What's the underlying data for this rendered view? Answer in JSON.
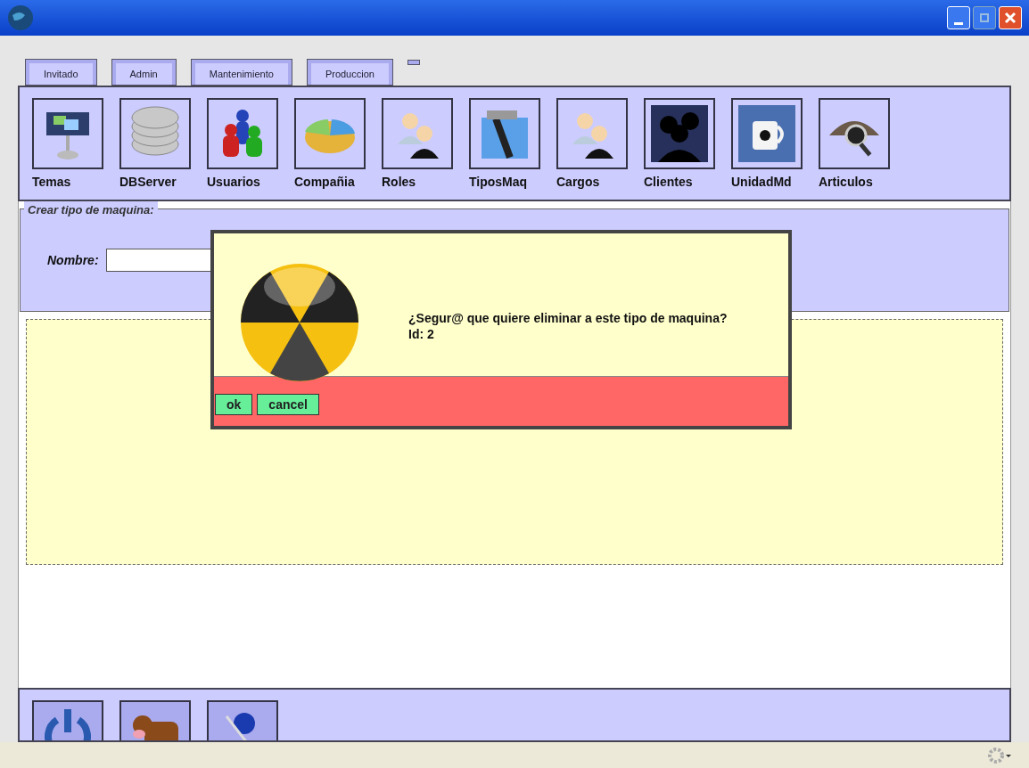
{
  "tabs": [
    {
      "label": "Invitado"
    },
    {
      "label": "Admin"
    },
    {
      "label": "Mantenimiento"
    },
    {
      "label": "Produccion"
    }
  ],
  "toolbar": [
    {
      "label": "Temas"
    },
    {
      "label": "DBServer"
    },
    {
      "label": "Usuarios"
    },
    {
      "label": "Compañia"
    },
    {
      "label": "Roles"
    },
    {
      "label": "TiposMaq"
    },
    {
      "label": "Cargos"
    },
    {
      "label": "Clientes"
    },
    {
      "label": "UnidadMd"
    },
    {
      "label": "Articulos"
    }
  ],
  "form": {
    "title": "Crear tipo de maquina:",
    "name_label": "Nombre:"
  },
  "dialog": {
    "message": "¿Segur@ que quiere eliminar a este tipo de maquina?",
    "detail": "Id: 2",
    "buttons": [
      "ok",
      "cancel"
    ]
  }
}
